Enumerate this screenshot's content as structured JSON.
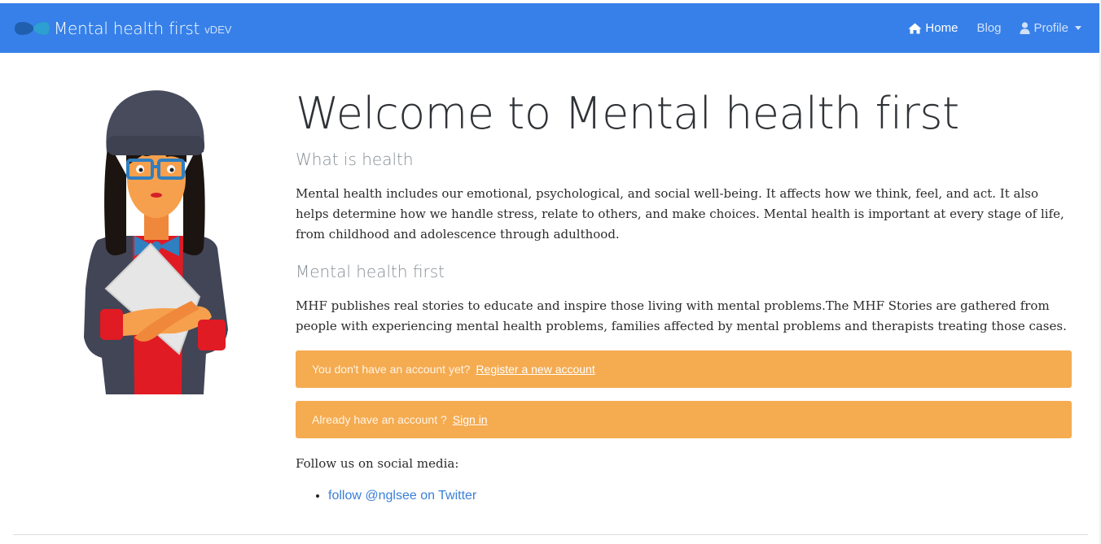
{
  "nav": {
    "brand": "Mental health first",
    "version": "vDEV",
    "items": [
      {
        "label": "Home",
        "icon": "home-icon",
        "active": true
      },
      {
        "label": "Blog",
        "active": false
      },
      {
        "label": "Profile",
        "icon": "user-icon",
        "dropdown": true,
        "active": false
      }
    ]
  },
  "main": {
    "title": "Welcome to Mental health first",
    "section1_heading": "What is health",
    "section1_text": "Mental health includes our emotional, psychological, and social well-being. It affects how we think, feel, and act. It also helps determine how we handle stress, relate to others, and make choices. Mental health is important at every stage of life, from childhood and adolescence through adulthood.",
    "section2_heading": "Mental health first",
    "section2_text": "MHF publishes real stories to educate and inspire those living with mental problems.The MHF Stories are gathered from people with experiencing mental health problems, families affected by mental problems and therapists treating those cases.",
    "register_alert": {
      "text": "You don't have an account yet?",
      "link": "Register a new account"
    },
    "signin_alert": {
      "text": "Already have an account ?",
      "link": "Sign in"
    },
    "follow_label": "Follow us on social media:",
    "social_links": [
      "follow @nglsee on Twitter"
    ]
  },
  "colors": {
    "navbar": "#3780e9",
    "alert": "#f5ab50",
    "link": "#3a7fd6"
  }
}
